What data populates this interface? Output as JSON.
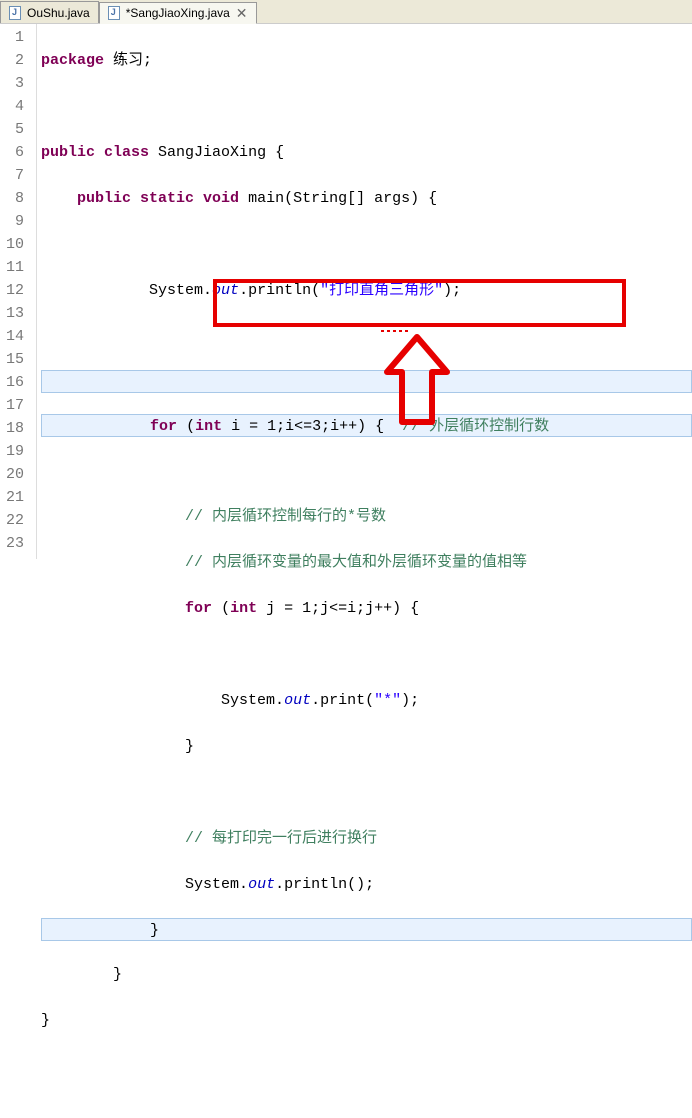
{
  "tabs": [
    {
      "label": "OuShu.java",
      "dirty": "",
      "active": false
    },
    {
      "label": "*SangJiaoXing.java",
      "dirty": "",
      "active": true
    }
  ],
  "close_glyph": "✕",
  "lines": {
    "n1": "1",
    "n2": "2",
    "n3": "3",
    "n4": "4",
    "n5": "5",
    "n6": "6",
    "n7": "7",
    "n8": "8",
    "n9": "9",
    "n10": "10",
    "n11": "11",
    "n12": "12",
    "n13": "13",
    "n14": "14",
    "n15": "15",
    "n16": "16",
    "n17": "17",
    "n18": "18",
    "n19": "19",
    "n20": "20",
    "n21": "21",
    "n22": "22",
    "n23": "23"
  },
  "code": {
    "l1_kw": "package",
    "l1_pkg": " 练习;",
    "l3_kw": "public class",
    "l3_name": " SangJiaoXing {",
    "l4_kw1": "    public static void",
    "l4_name": " main(String[] args) {",
    "l6_lead": "            System.",
    "l6_out": "out",
    "l6_mid": ".println(",
    "l6_str": "\"打印直角三角形\"",
    "l6_end": ");",
    "l9_lead": "            ",
    "l9_for": "for",
    "l9_a": " (",
    "l9_int": "int",
    "l9_b": " i = 1;i<=3;i++) {  ",
    "l9_cmt": "// 外层循环控制行数",
    "l11_lead": "                ",
    "l11_cmt": "// 内层循环控制每行的*号数",
    "l12_lead": "                ",
    "l12_cmt": "// 内层循环变量的最大值和外层循环变量的值相等",
    "l13_lead": "                ",
    "l13_for": "for",
    "l13_a": " (",
    "l13_int": "int",
    "l13_b": " j = 1;j<=i;j++) {",
    "l15_lead": "                    System.",
    "l15_out": "out",
    "l15_mid": ".print(",
    "l15_str": "\"*\"",
    "l15_end": ");",
    "l16": "                }",
    "l18_lead": "                ",
    "l18_cmt": "// 每打印完一行后进行换行",
    "l19_lead": "                System.",
    "l19_out": "out",
    "l19_end": ".println();",
    "l20": "            }",
    "l21": "        }",
    "l22": "}"
  }
}
